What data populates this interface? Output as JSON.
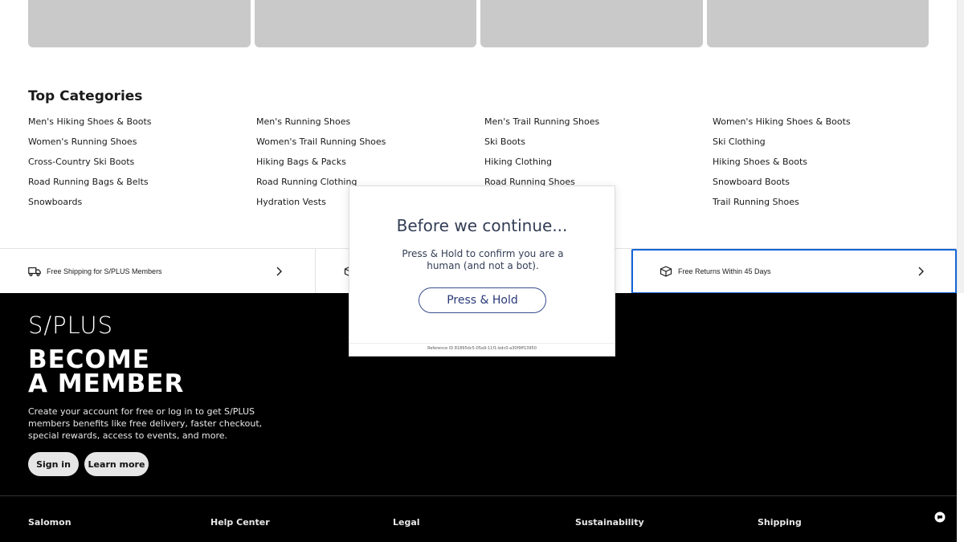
{
  "top_categories": {
    "title": "Top Categories",
    "columns": [
      [
        "Men's Hiking Shoes & Boots",
        "Women's Running Shoes",
        "Cross-Country Ski Boots",
        "Road Running Bags & Belts",
        "Snowboards"
      ],
      [
        "Men's Running Shoes",
        "Women's Trail Running Shoes",
        "Hiking Bags & Packs",
        "Road Running Clothing",
        "Hydration Vests"
      ],
      [
        "Men's Trail Running Shoes",
        "Ski Boots",
        "Hiking Clothing",
        "Road Running Shoes",
        ""
      ],
      [
        "Women's Hiking Shoes & Boots",
        "Ski Clothing",
        "Hiking Shoes & Boots",
        "Snowboard Boots",
        "Trail Running Shoes"
      ]
    ]
  },
  "benefits": [
    {
      "label": "Free Shipping for S/PLUS Members",
      "icon": "truck-icon"
    },
    {
      "label": "",
      "icon": "box-icon"
    },
    {
      "label": "Free Returns Within 45 Days",
      "icon": "box-icon"
    }
  ],
  "footer": {
    "logo_text": "S/PLUS",
    "become_line1": "BECOME",
    "become_line2": "A MEMBER",
    "description": "Create your account for free or log in to get S/PLUS members benefits like free delivery, faster checkout, special rewards, access to events, and more.",
    "sign_in": "Sign in",
    "learn_more": "Learn more",
    "columns": [
      "Salomon",
      "Help Center",
      "Legal",
      "Sustainability",
      "Shipping"
    ]
  },
  "modal": {
    "title": "Before we continue...",
    "message": "Press & Hold to confirm you are a human (and not a bot).",
    "button": "Press & Hold",
    "reference": "Reference ID 81895dc5-05a9-11f1-bdc0-a30f9ff13950"
  },
  "colors": {
    "modal_text": "#333d55",
    "modal_button_border": "#3a4d8f",
    "focus_outline": "#1565d8",
    "footer_bg": "#000000",
    "card_placeholder": "#c9c9c9"
  }
}
